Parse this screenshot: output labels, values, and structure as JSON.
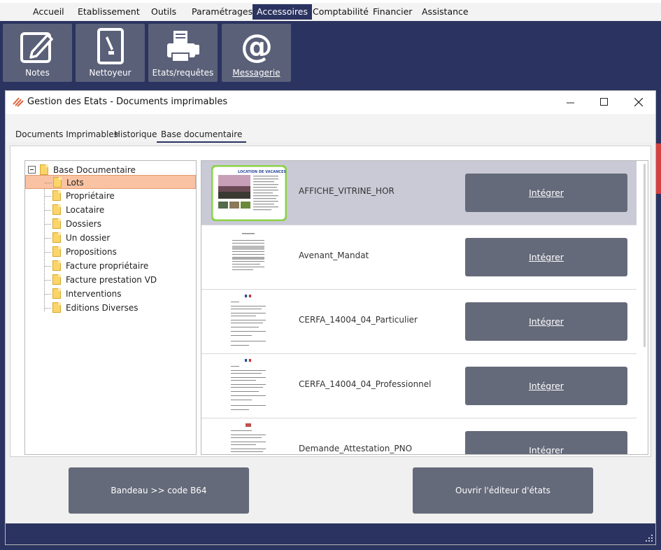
{
  "menu": {
    "items": [
      {
        "label": "Accueil",
        "active": false
      },
      {
        "label": "Etablissement",
        "active": false
      },
      {
        "label": "Outils",
        "active": false
      },
      {
        "label": "Paramétrages",
        "active": false
      },
      {
        "label": "Accessoires",
        "active": true
      },
      {
        "label": "Comptabilité",
        "active": false
      },
      {
        "label": "Financier",
        "active": false
      },
      {
        "label": "Assistance",
        "active": false
      }
    ]
  },
  "ribbon": {
    "buttons": [
      {
        "label": "Notes",
        "icon": "edit-icon"
      },
      {
        "label": "Nettoyeur",
        "icon": "cleaner-icon"
      },
      {
        "label": "Etats/requêtes",
        "icon": "printer-icon"
      },
      {
        "label": "Messagerie",
        "icon": "at-icon"
      }
    ]
  },
  "dialog": {
    "title": "Gestion des Etats - Documents imprimables",
    "tabs": [
      {
        "label": "Documents Imprimables",
        "active": false
      },
      {
        "label": "Historique",
        "active": false
      },
      {
        "label": "Base documentaire",
        "active": true
      }
    ],
    "tree": {
      "root": "Base Documentaire",
      "nodes": [
        {
          "label": "Lots",
          "selected": true
        },
        {
          "label": "Propriétaire",
          "selected": false
        },
        {
          "label": "Locataire",
          "selected": false
        },
        {
          "label": "Dossiers",
          "selected": false
        },
        {
          "label": "Un dossier",
          "selected": false
        },
        {
          "label": "Propositions",
          "selected": false
        },
        {
          "label": "Facture propriétaire",
          "selected": false
        },
        {
          "label": "Facture prestation VD",
          "selected": false
        },
        {
          "label": "Interventions",
          "selected": false
        },
        {
          "label": "Editions Diverses",
          "selected": false
        }
      ]
    },
    "documents": [
      {
        "name": "AFFICHE_VITRINE_HOR",
        "action": "Intégrer",
        "selected": true,
        "thumb_title": "LOCATION DE VACANCES"
      },
      {
        "name": "Avenant_Mandat",
        "action": "Intégrer",
        "selected": false
      },
      {
        "name": "CERFA_14004_04_Particulier",
        "action": "Intégrer",
        "selected": false
      },
      {
        "name": "CERFA_14004_04_Professionnel",
        "action": "Intégrer",
        "selected": false
      },
      {
        "name": "Demande_Attestation_PNO",
        "action": "Intégrer",
        "selected": false
      }
    ],
    "buttons": {
      "bandeau": "Bandeau >> code B64",
      "editor": "Ouvrir l'éditeur d'états"
    }
  },
  "colors": {
    "navy": "#2b3360",
    "button_gray": "#656a7a",
    "selection": "#f9c3a3",
    "row_selected": "#c9cad6",
    "thumb_highlight": "#8dd14a"
  }
}
